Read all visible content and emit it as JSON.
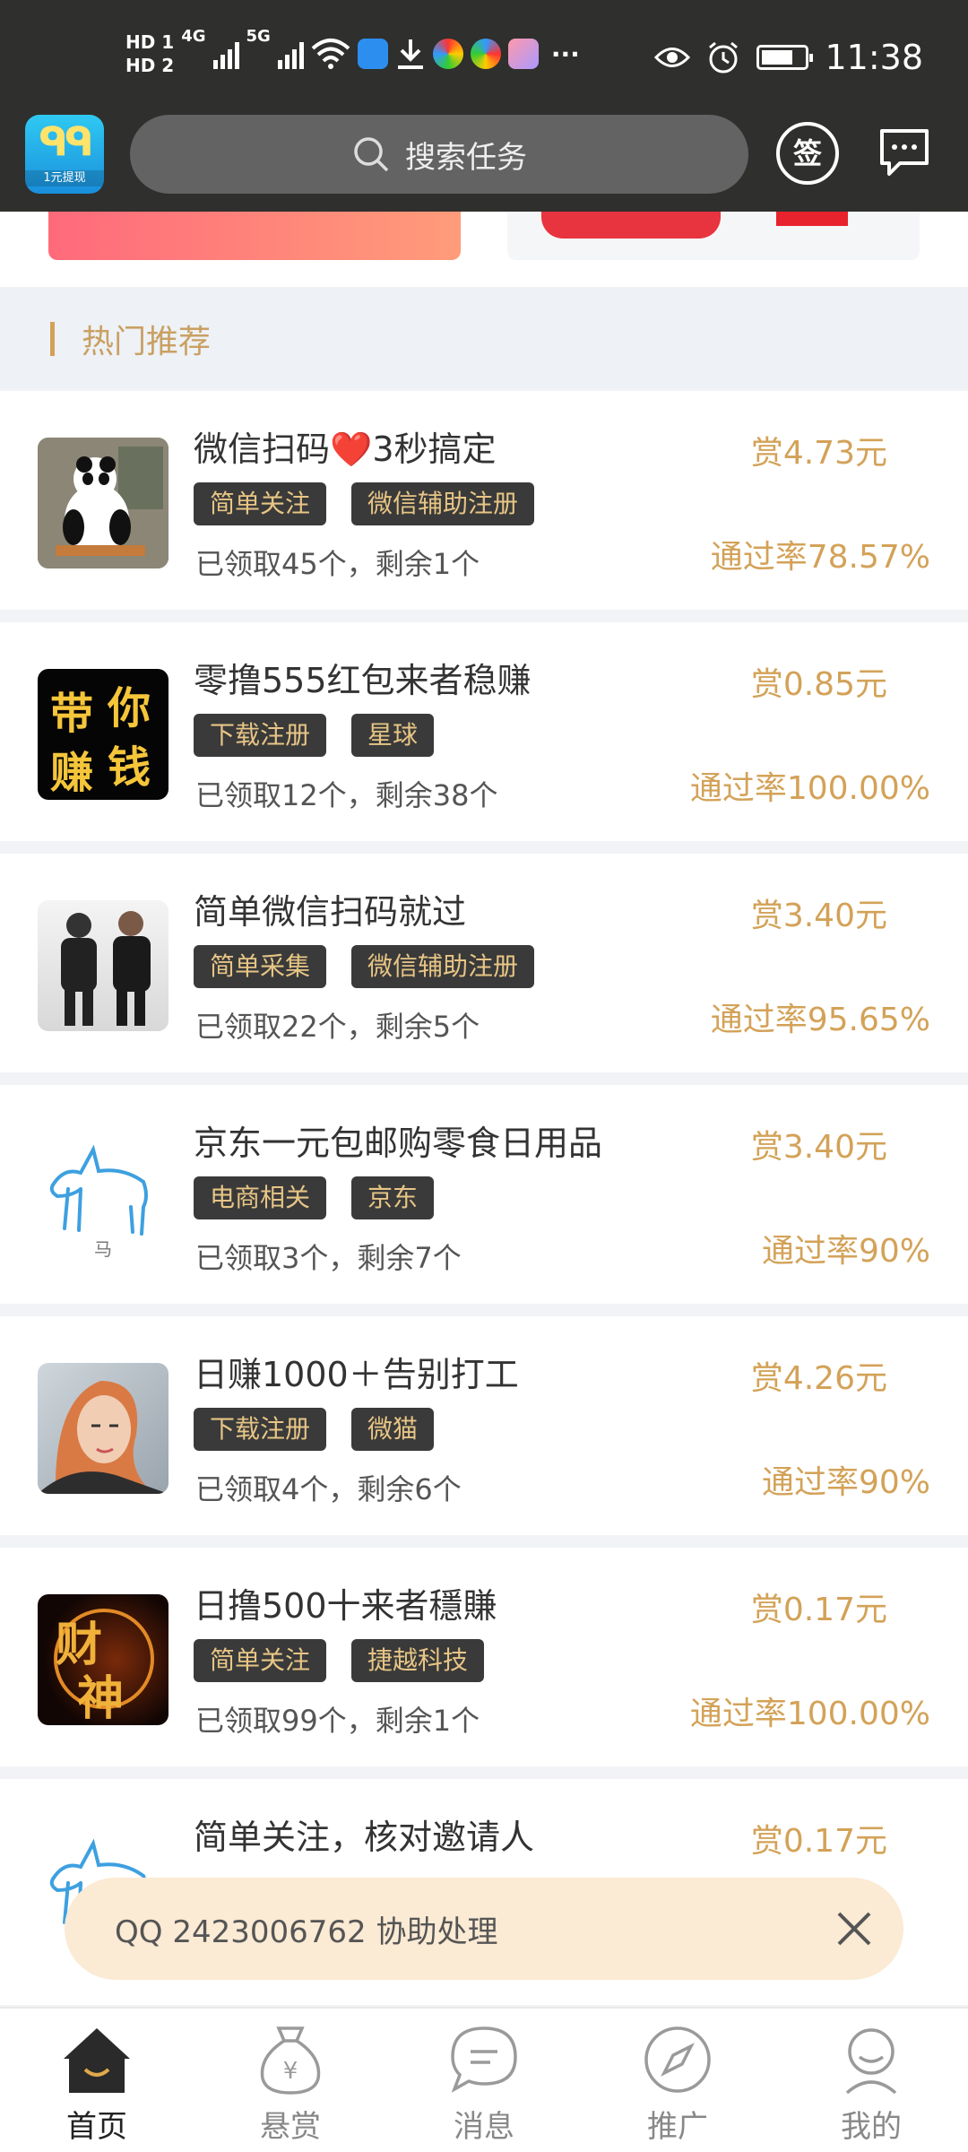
{
  "status_bar": {
    "left_icons": [
      "hd1-indicator",
      "hd2-indicator",
      "signal-4g",
      "signal-5g",
      "wifi",
      "app-icons",
      "more-dots"
    ],
    "hd1": "HD 1",
    "hd2": "HD 2",
    "net1": "4G",
    "net2": "5G",
    "more": "···",
    "time": "11:38"
  },
  "header": {
    "logo_sub": "1元提现",
    "search_placeholder": "搜索任务",
    "checkin_label": "签"
  },
  "section": {
    "title": "热门推荐"
  },
  "tasks": [
    {
      "title": "微信扫码❤️3秒搞定",
      "tags": [
        "简单关注",
        "微信辅助注册"
      ],
      "meta": "已领取45个，剩余1个",
      "reward": "赏4.73元",
      "rate": "通过率78.57%"
    },
    {
      "title": "零撸555红包来者稳赚",
      "tags": [
        "下载注册",
        "星球"
      ],
      "meta": "已领取12个，剩余38个",
      "reward": "赏0.85元",
      "rate": "通过率100.00%",
      "thumb_text": [
        "带",
        "你",
        "赚",
        "钱"
      ]
    },
    {
      "title": "简单微信扫码就过",
      "tags": [
        "简单采集",
        "微信辅助注册"
      ],
      "meta": "已领取22个，剩余5个",
      "reward": "赏3.40元",
      "rate": "通过率95.65%"
    },
    {
      "title": "京东一元包邮购零食日用品",
      "tags": [
        "电商相关",
        "京东"
      ],
      "meta": "已领取3个，剩余7个",
      "reward": "赏3.40元",
      "rate": "通过率90%",
      "thumb_caption": "马"
    },
    {
      "title": "日赚1000＋告别打工",
      "tags": [
        "下载注册",
        "微猫"
      ],
      "meta": "已领取4个，剩余6个",
      "reward": "赏4.26元",
      "rate": "通过率90%"
    },
    {
      "title": "日撸500十来者穩賺",
      "tags": [
        "简单关注",
        "捷越科技"
      ],
      "meta": "已领取99个，剩余1个",
      "reward": "赏0.17元",
      "rate": "通过率100.00%",
      "thumb_text": [
        "财",
        "神"
      ]
    },
    {
      "title": "简单关注，核对邀请人",
      "reward": "赏0.17元"
    }
  ],
  "toast": {
    "text": "QQ 2423006762 协助处理"
  },
  "bottom_nav": [
    {
      "label": "首页",
      "icon": "home-icon"
    },
    {
      "label": "悬赏",
      "icon": "money-bag-icon"
    },
    {
      "label": "消息",
      "icon": "chat-icon"
    },
    {
      "label": "推广",
      "icon": "compass-icon"
    },
    {
      "label": "我的",
      "icon": "user-icon"
    }
  ],
  "colors": {
    "accent": "#d3a258",
    "header_bg": "#2f2f2d",
    "tag_bg": "#3a3a3a",
    "tag_text": "#e7c585",
    "toast_bg": "#fbead4"
  }
}
